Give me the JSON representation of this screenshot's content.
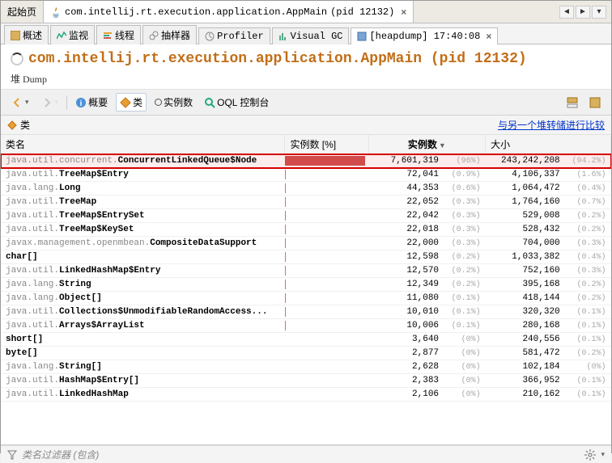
{
  "topTabs": {
    "start": "起始页",
    "mainPrefix": "com.intellij.rt.execution.application.AppMain",
    "mainPid": "(pid 12132)"
  },
  "subTabs": {
    "overview": "概述",
    "monitor": "监视",
    "threads": "线程",
    "sampler": "抽样器",
    "profiler": "Profiler",
    "visualgc": "Visual GC",
    "heapdump": "[heapdump] 17:40:08"
  },
  "header": {
    "title": "com.intellij.rt.execution.application.AppMain (pid 12132)",
    "heapLabel": "堆 Dump"
  },
  "toolbar": {
    "overview": "概要",
    "classes": "类",
    "instances": "实例数",
    "oql": "OQL 控制台"
  },
  "section": {
    "classesLabel": "类",
    "compareLink": "与另一个堆转储进行比较"
  },
  "columns": {
    "className": "类名",
    "instancesPct": "实例数 [%]",
    "instances": "实例数",
    "size": "大小"
  },
  "filter": {
    "label": "类名过滤器 (包含)",
    "placeholder": ""
  },
  "rows": [
    {
      "hl": true,
      "prefix": "java.util.concurrent.",
      "name": "ConcurrentLinkedQueue$Node",
      "barPct": 96,
      "count": "7,601,319",
      "countPct": "(96%)",
      "size": "243,242,208",
      "sizePct": "(94.2%)"
    },
    {
      "prefix": "java.util.",
      "name": "TreeMap$Entry",
      "barPct": 0.9,
      "count": "72,041",
      "countPct": "(0.9%)",
      "size": "4,106,337",
      "sizePct": "(1.6%)"
    },
    {
      "prefix": "java.lang.",
      "name": "Long",
      "barPct": 0.6,
      "count": "44,353",
      "countPct": "(0.6%)",
      "size": "1,064,472",
      "sizePct": "(0.4%)"
    },
    {
      "prefix": "java.util.",
      "name": "TreeMap",
      "barPct": 0.3,
      "count": "22,052",
      "countPct": "(0.3%)",
      "size": "1,764,160",
      "sizePct": "(0.7%)"
    },
    {
      "prefix": "java.util.",
      "name": "TreeMap$EntrySet",
      "barPct": 0.3,
      "count": "22,042",
      "countPct": "(0.3%)",
      "size": "529,008",
      "sizePct": "(0.2%)"
    },
    {
      "prefix": "java.util.",
      "name": "TreeMap$KeySet",
      "barPct": 0.3,
      "count": "22,018",
      "countPct": "(0.3%)",
      "size": "528,432",
      "sizePct": "(0.2%)"
    },
    {
      "prefix": "javax.management.openmbean.",
      "name": "CompositeDataSupport",
      "barPct": 0.3,
      "count": "22,000",
      "countPct": "(0.3%)",
      "size": "704,000",
      "sizePct": "(0.3%)"
    },
    {
      "prefix": "",
      "name": "char[]",
      "barPct": 0.2,
      "count": "12,598",
      "countPct": "(0.2%)",
      "size": "1,033,382",
      "sizePct": "(0.4%)"
    },
    {
      "prefix": "java.util.",
      "name": "LinkedHashMap$Entry",
      "barPct": 0.2,
      "count": "12,570",
      "countPct": "(0.2%)",
      "size": "752,160",
      "sizePct": "(0.3%)"
    },
    {
      "prefix": "java.lang.",
      "name": "String",
      "barPct": 0.2,
      "count": "12,349",
      "countPct": "(0.2%)",
      "size": "395,168",
      "sizePct": "(0.2%)"
    },
    {
      "prefix": "java.lang.",
      "name": "Object[]",
      "barPct": 0.1,
      "count": "11,080",
      "countPct": "(0.1%)",
      "size": "418,144",
      "sizePct": "(0.2%)"
    },
    {
      "prefix": "java.util.",
      "name": "Collections$UnmodifiableRandomAccess...",
      "barPct": 0.1,
      "count": "10,010",
      "countPct": "(0.1%)",
      "size": "320,320",
      "sizePct": "(0.1%)"
    },
    {
      "prefix": "java.util.",
      "name": "Arrays$ArrayList",
      "barPct": 0.1,
      "count": "10,006",
      "countPct": "(0.1%)",
      "size": "280,168",
      "sizePct": "(0.1%)"
    },
    {
      "prefix": "",
      "name": "short[]",
      "barPct": 0,
      "count": "3,640",
      "countPct": "(0%)",
      "size": "240,556",
      "sizePct": "(0.1%)"
    },
    {
      "prefix": "",
      "name": "byte[]",
      "barPct": 0,
      "count": "2,877",
      "countPct": "(0%)",
      "size": "581,472",
      "sizePct": "(0.2%)"
    },
    {
      "prefix": "java.lang.",
      "name": "String[]",
      "barPct": 0,
      "count": "2,628",
      "countPct": "(0%)",
      "size": "102,184",
      "sizePct": "(0%)"
    },
    {
      "prefix": "java.util.",
      "name": "HashMap$Entry[]",
      "barPct": 0,
      "count": "2,383",
      "countPct": "(0%)",
      "size": "366,952",
      "sizePct": "(0.1%)"
    },
    {
      "prefix": "java.util.",
      "name": "LinkedHashMap",
      "barPct": 0,
      "count": "2,106",
      "countPct": "(0%)",
      "size": "210,162",
      "sizePct": "(0.1%)"
    }
  ]
}
